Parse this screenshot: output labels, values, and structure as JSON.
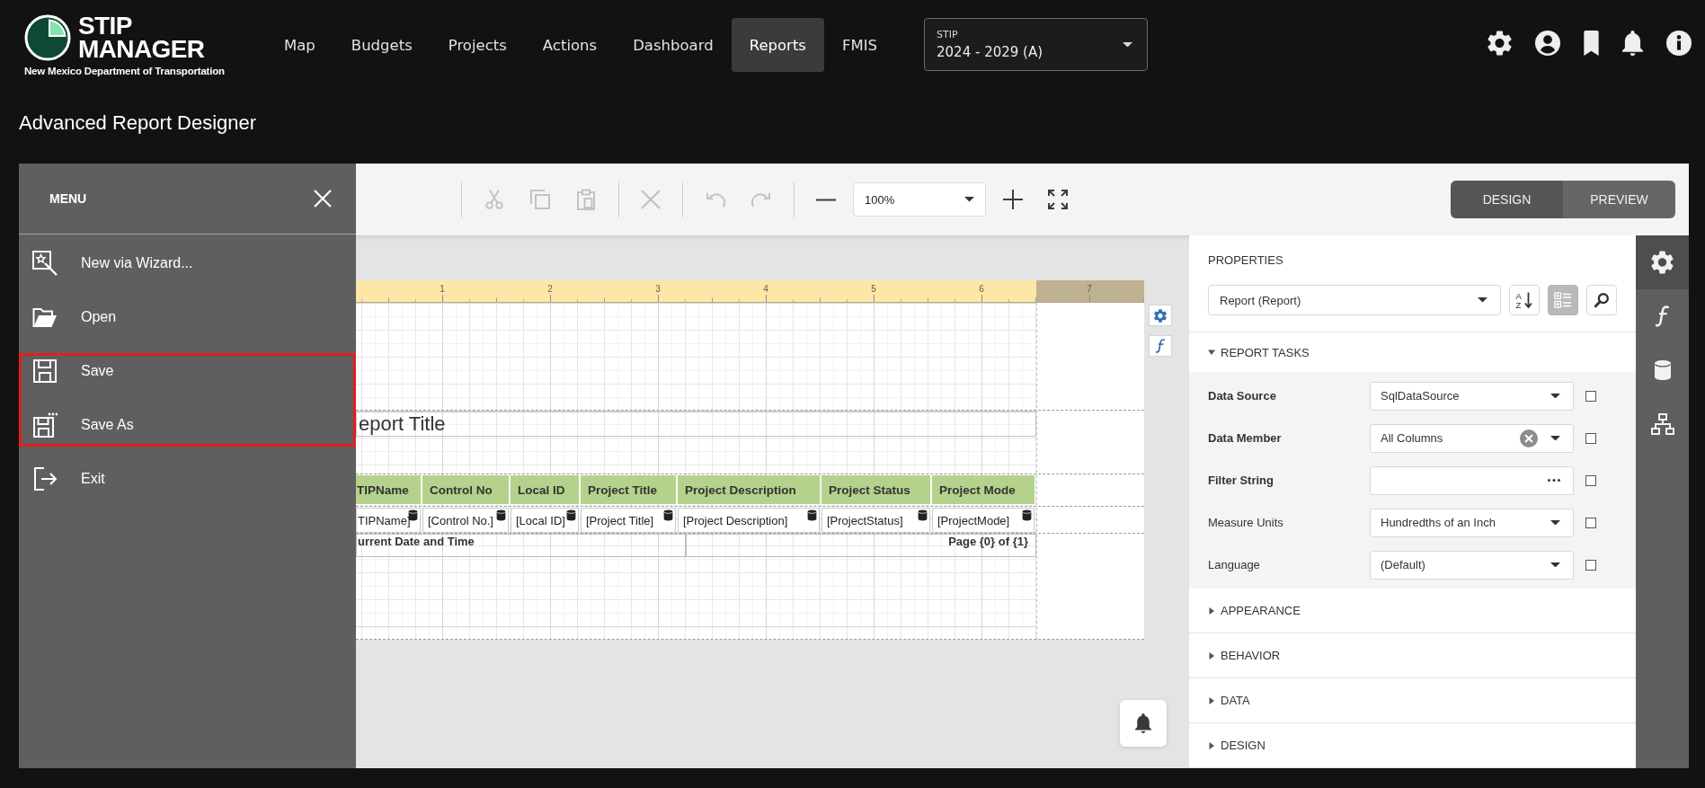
{
  "header": {
    "logo": {
      "line_1": "STIP",
      "line_2": "MANAGER",
      "subtitle": "New Mexico Department of Transportation"
    },
    "nav": [
      {
        "label": "Map",
        "selected": false
      },
      {
        "label": "Budgets",
        "selected": false
      },
      {
        "label": "Projects",
        "selected": false
      },
      {
        "label": "Actions",
        "selected": false
      },
      {
        "label": "Dashboard",
        "selected": false
      },
      {
        "label": "Reports",
        "selected": true
      },
      {
        "label": "FMIS",
        "selected": false
      }
    ],
    "program_select": {
      "label": "STIP",
      "value": "2024 - 2029 (A)"
    }
  },
  "page_title": "Advanced Report Designer",
  "menu": {
    "title": "MENU",
    "items": [
      {
        "label": "New via Wizard...",
        "kind": "wizard",
        "highlighted": false
      },
      {
        "label": "Open",
        "kind": "open",
        "highlighted": false
      },
      {
        "label": "Save",
        "kind": "save",
        "highlighted": true
      },
      {
        "label": "Save As",
        "kind": "save-as",
        "highlighted": true
      },
      {
        "label": "Exit",
        "kind": "exit",
        "highlighted": false
      }
    ]
  },
  "toolbar": {
    "groups": [
      [
        {
          "kind": "cut",
          "disabled": true
        },
        {
          "kind": "copy",
          "disabled": true
        },
        {
          "kind": "paste",
          "disabled": true
        }
      ],
      [
        {
          "kind": "delete",
          "disabled": true
        }
      ],
      [
        {
          "kind": "undo",
          "disabled": true
        },
        {
          "kind": "redo",
          "disabled": true
        }
      ],
      [
        {
          "kind": "zoom-out",
          "disabled": false
        },
        {
          "kind": "zoom-select",
          "value": "100%"
        },
        {
          "kind": "zoom-in",
          "disabled": false
        },
        {
          "kind": "fit",
          "disabled": false
        }
      ]
    ],
    "modes": [
      {
        "label": "DESIGN",
        "selected": true
      },
      {
        "label": "PREVIEW",
        "selected": false
      }
    ]
  },
  "report": {
    "ruler": [
      "1",
      "2",
      "3",
      "4",
      "5",
      "6",
      "7"
    ],
    "title": "eport Title",
    "columns": [
      {
        "header": "TIPName",
        "field": "TIPName]"
      },
      {
        "header": "Control No",
        "field": "[Control No.]"
      },
      {
        "header": "Local ID",
        "field": "[Local ID]"
      },
      {
        "header": "Project Title",
        "field": "[Project Title]"
      },
      {
        "header": "Project Description",
        "field": "[Project Description]"
      },
      {
        "header": "Project Status",
        "field": "[ProjectStatus]"
      },
      {
        "header": "Project Mode",
        "field": "[ProjectMode]"
      }
    ],
    "footer": {
      "left": "urrent Date and Time",
      "right": "Page {0} of {1}"
    }
  },
  "properties": {
    "title": "PROPERTIES",
    "object": "Report (Report)",
    "view_buttons": [
      {
        "kind": "sort",
        "letters": [
          "A",
          "Z"
        ],
        "selected": false
      },
      {
        "kind": "categories",
        "selected": true
      },
      {
        "kind": "search",
        "selected": false
      }
    ],
    "sections": [
      {
        "title": "REPORT TASKS",
        "expanded": true,
        "rows": [
          {
            "label": "Data Source",
            "bold": true,
            "kind": "select",
            "value": "SqlDataSource",
            "checked": false
          },
          {
            "label": "Data Member",
            "bold": true,
            "kind": "select-clear",
            "value": "All Columns",
            "checked": false
          },
          {
            "label": "Filter String",
            "bold": true,
            "kind": "ellipsis",
            "checked": false
          },
          {
            "label": "Measure Units",
            "bold": false,
            "kind": "select",
            "value": "Hundredths of an Inch",
            "checked": false
          },
          {
            "label": "Language",
            "bold": false,
            "kind": "select",
            "value": "(Default)",
            "checked": false
          }
        ]
      },
      {
        "title": "APPEARANCE",
        "expanded": false
      },
      {
        "title": "BEHAVIOR",
        "expanded": false
      },
      {
        "title": "DATA",
        "expanded": false
      },
      {
        "title": "DESIGN",
        "expanded": false
      }
    ]
  },
  "side_tabs": [
    {
      "kind": "properties",
      "selected": true
    },
    {
      "kind": "expressions",
      "selected": false
    },
    {
      "kind": "data-source",
      "selected": false
    },
    {
      "kind": "outline",
      "selected": false
    }
  ]
}
